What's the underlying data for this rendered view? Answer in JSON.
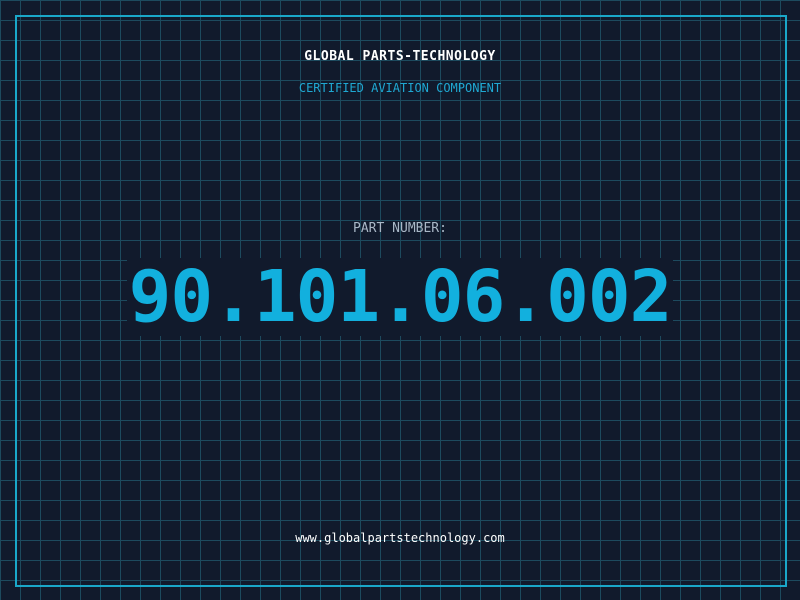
{
  "header": {
    "company_name": "GLOBAL PARTS-TECHNOLOGY",
    "subtitle": "CERTIFIED AVIATION COMPONENT"
  },
  "part": {
    "label": "PART NUMBER:",
    "number": "90.101.06.002"
  },
  "footer": {
    "website": "www.globalpartstechnology.com"
  },
  "colors": {
    "background": "#111a2c",
    "grid": "#1d4a5e",
    "accent": "#1aa7c9",
    "part_number": "#12b0de"
  }
}
